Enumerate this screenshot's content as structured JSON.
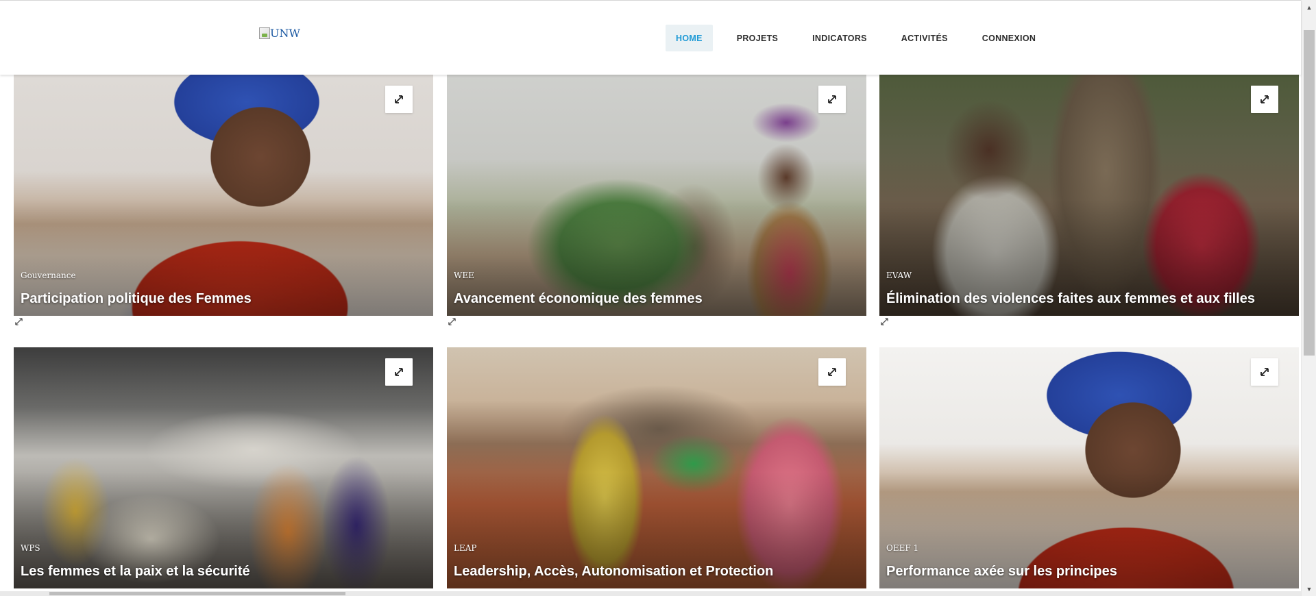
{
  "header": {
    "logo_alt": "UNW",
    "nav": [
      {
        "label": "HOME",
        "active": true
      },
      {
        "label": "PROJETS",
        "active": false
      },
      {
        "label": "INDICATORS",
        "active": false
      },
      {
        "label": "ACTIVITÉS",
        "active": false
      },
      {
        "label": "CONNEXION",
        "active": false
      }
    ]
  },
  "cards": [
    {
      "tag": "Gouvernance",
      "title": "Participation politique des Femmes"
    },
    {
      "tag": "WEE",
      "title": "Avancement économique des femmes"
    },
    {
      "tag": "EVAW",
      "title": "Élimination des violences faites aux femmes et aux filles"
    },
    {
      "tag": "WPS",
      "title": "Les femmes et la paix et la sécurité"
    },
    {
      "tag": "LEAP",
      "title": "Leadership, Accès, Autonomisation et Protection"
    },
    {
      "tag": "OEEF 1",
      "title": "Performance axée sur les principes"
    }
  ],
  "icons": {
    "expand": "expand-icon",
    "scroll_up": "scroll-up-arrow-icon",
    "scroll_down": "scroll-down-arrow-icon"
  },
  "colors": {
    "accent": "#1e9ad6",
    "active_bg": "#eaf1f4",
    "nav_text": "#2b2b2b"
  }
}
